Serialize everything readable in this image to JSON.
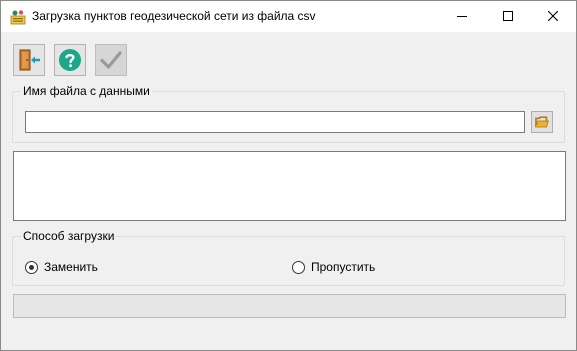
{
  "window": {
    "title": "Загрузка пунктов геодезической сети из файла csv",
    "icon": "geodetic-points-icon"
  },
  "window_controls": [
    "minimize-icon",
    "maximize-icon",
    "close-icon"
  ],
  "toolbar": {
    "buttons": [
      {
        "icon": "exit-door-icon",
        "enabled": true
      },
      {
        "icon": "help-icon",
        "enabled": true
      },
      {
        "icon": "checkmark-icon",
        "enabled": false
      }
    ]
  },
  "file_group": {
    "label": "Имя файла с данными",
    "input_value": "",
    "browse_icon": "folder-open-icon"
  },
  "log": {
    "text": ""
  },
  "mode_group": {
    "label": "Способ загрузки",
    "options": [
      {
        "label": "Заменить",
        "selected": true
      },
      {
        "label": "Пропустить",
        "selected": false
      }
    ]
  },
  "progress": {
    "value": 0
  },
  "colors": {
    "help_accent": "#1ca68a",
    "folder": "#f2b12c",
    "exit_arrow": "#1aa0b4"
  }
}
